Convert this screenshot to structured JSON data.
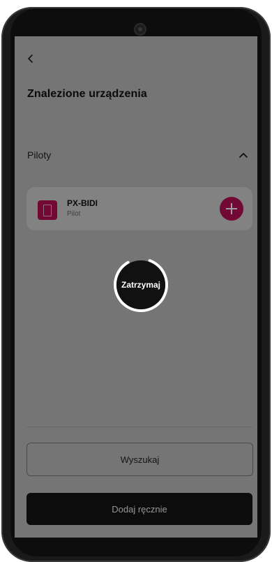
{
  "header": {
    "title": "Znalezione urządzenia"
  },
  "section": {
    "label": "Piloty"
  },
  "device": {
    "name": "PX-BIDI",
    "type": "Pilot"
  },
  "actions": {
    "search_label": "Wyszukaj",
    "add_manual_label": "Dodaj ręcznie",
    "stop_label": "Zatrzymaj"
  },
  "colors": {
    "accent": "#b80d55",
    "primary_button": "#141414"
  },
  "icons": {
    "back": "back-arrow-icon",
    "collapse": "chevron-up-icon",
    "device": "remote-control-icon",
    "add": "plus-icon"
  }
}
